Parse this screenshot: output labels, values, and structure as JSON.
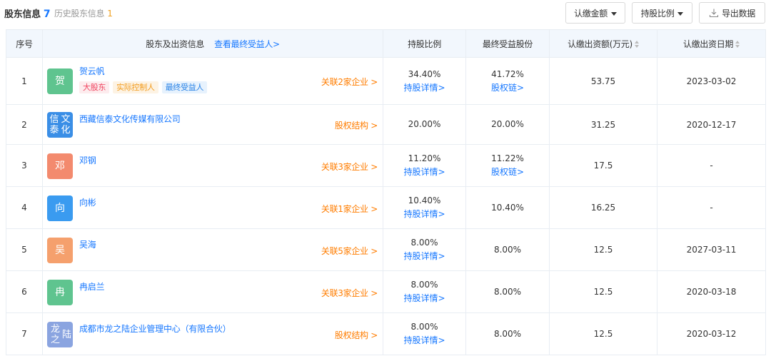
{
  "header": {
    "title": "股东信息",
    "count": "7",
    "history_label": "历史股东信息",
    "history_count": "1",
    "buttons": {
      "amount": "认缴金额",
      "ratio": "持股比例",
      "export": "导出数据"
    }
  },
  "table": {
    "columns": {
      "seq": "序号",
      "name": "股东及出资信息",
      "name_link": "查看最终受益人>",
      "ratio": "持股比例",
      "final": "最终受益股份",
      "amount": "认缴出资额(万元)",
      "date": "认缴出资日期"
    },
    "rows": [
      {
        "seq": "1",
        "avatar": "贺",
        "avatar_color": "#5fc48f",
        "name": "贺云帆",
        "tags": [
          "大股东",
          "实际控制人",
          "最终受益人"
        ],
        "relation": "关联2家企业 >",
        "ratio": "34.40%",
        "ratio_link": "持股详情>",
        "final": "41.72%",
        "final_link": "股权链>",
        "amount": "53.75",
        "date": "2023-03-02"
      },
      {
        "seq": "2",
        "avatar": "信泰文化",
        "avatar_color": "#3a8ee6",
        "name": "西藏信泰文化传媒有限公司",
        "tags": [],
        "relation": "股权结构 >",
        "ratio": "20.00%",
        "ratio_link": "",
        "final": "20.00%",
        "final_link": "",
        "amount": "31.25",
        "date": "2020-12-17"
      },
      {
        "seq": "3",
        "avatar": "邓",
        "avatar_color": "#f38a6e",
        "name": "邓钢",
        "tags": [],
        "relation": "关联3家企业 >",
        "ratio": "11.20%",
        "ratio_link": "持股详情>",
        "final": "11.22%",
        "final_link": "股权链>",
        "amount": "17.5",
        "date": "-"
      },
      {
        "seq": "4",
        "avatar": "向",
        "avatar_color": "#3a9bf0",
        "name": "向彬",
        "tags": [],
        "relation": "关联1家企业 >",
        "ratio": "10.40%",
        "ratio_link": "持股详情>",
        "final": "10.40%",
        "final_link": "",
        "amount": "16.25",
        "date": "-"
      },
      {
        "seq": "5",
        "avatar": "吴",
        "avatar_color": "#f5a06d",
        "name": "吴海",
        "tags": [],
        "relation": "关联5家企业 >",
        "ratio": "8.00%",
        "ratio_link": "持股详情>",
        "final": "8.00%",
        "final_link": "",
        "amount": "12.5",
        "date": "2027-03-11"
      },
      {
        "seq": "6",
        "avatar": "冉",
        "avatar_color": "#5fc48f",
        "name": "冉启兰",
        "tags": [],
        "relation": "关联3家企业 >",
        "ratio": "8.00%",
        "ratio_link": "持股详情>",
        "final": "8.00%",
        "final_link": "",
        "amount": "12.5",
        "date": "2020-03-18"
      },
      {
        "seq": "7",
        "avatar": "龙之陆",
        "avatar_color": "#8aa4e0",
        "name": "成都市龙之陆企业管理中心（有限合伙）",
        "tags": [],
        "relation": "股权结构 >",
        "ratio": "8.00%",
        "ratio_link": "持股详情>",
        "final": "8.00%",
        "final_link": "",
        "amount": "12.5",
        "date": "2020-03-12"
      }
    ]
  },
  "tag_colors": {
    "大股东": {
      "bg": "#fdecee",
      "fg": "#f0445f"
    },
    "实际控制人": {
      "bg": "#fdf3e4",
      "fg": "#f29a1a"
    },
    "最终受益人": {
      "bg": "#e7f2fd",
      "fg": "#2a83e6"
    }
  },
  "icons": {
    "download": "download-icon",
    "caret": "caret-down-icon",
    "sort": "sort-icon"
  }
}
